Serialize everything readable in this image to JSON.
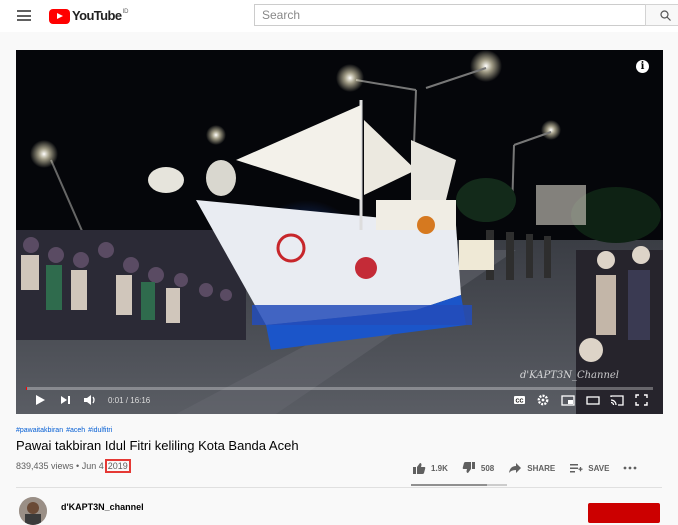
{
  "header": {
    "logo_text": "YouTube",
    "logo_country": "ID",
    "search_placeholder": "Search"
  },
  "player": {
    "watermark": "d'KAPT3N_Channel",
    "time_current": "0:01",
    "time_total": "16:16",
    "time_display": "0:01 / 16:16",
    "progress_fraction": 0.001
  },
  "video": {
    "hashtags": [
      "#pawaitakbiran",
      "#aceh",
      "#idulfitri"
    ],
    "title": "Pawai takbiran Idul Fitri keliling Kota Banda Aceh",
    "views_date": "839,435 views • Jun 4",
    "year": "2019"
  },
  "actions": {
    "likes": "1.9K",
    "dislikes": "508",
    "share": "SHARE",
    "save": "SAVE",
    "like_fraction": 0.79
  },
  "channel": {
    "name": "d'KAPT3N_channel"
  },
  "colors": {
    "brand_red": "#ff0000",
    "link_blue": "#065fd4",
    "highlight_box": "#e53935",
    "subscribe": "#cc0000"
  }
}
